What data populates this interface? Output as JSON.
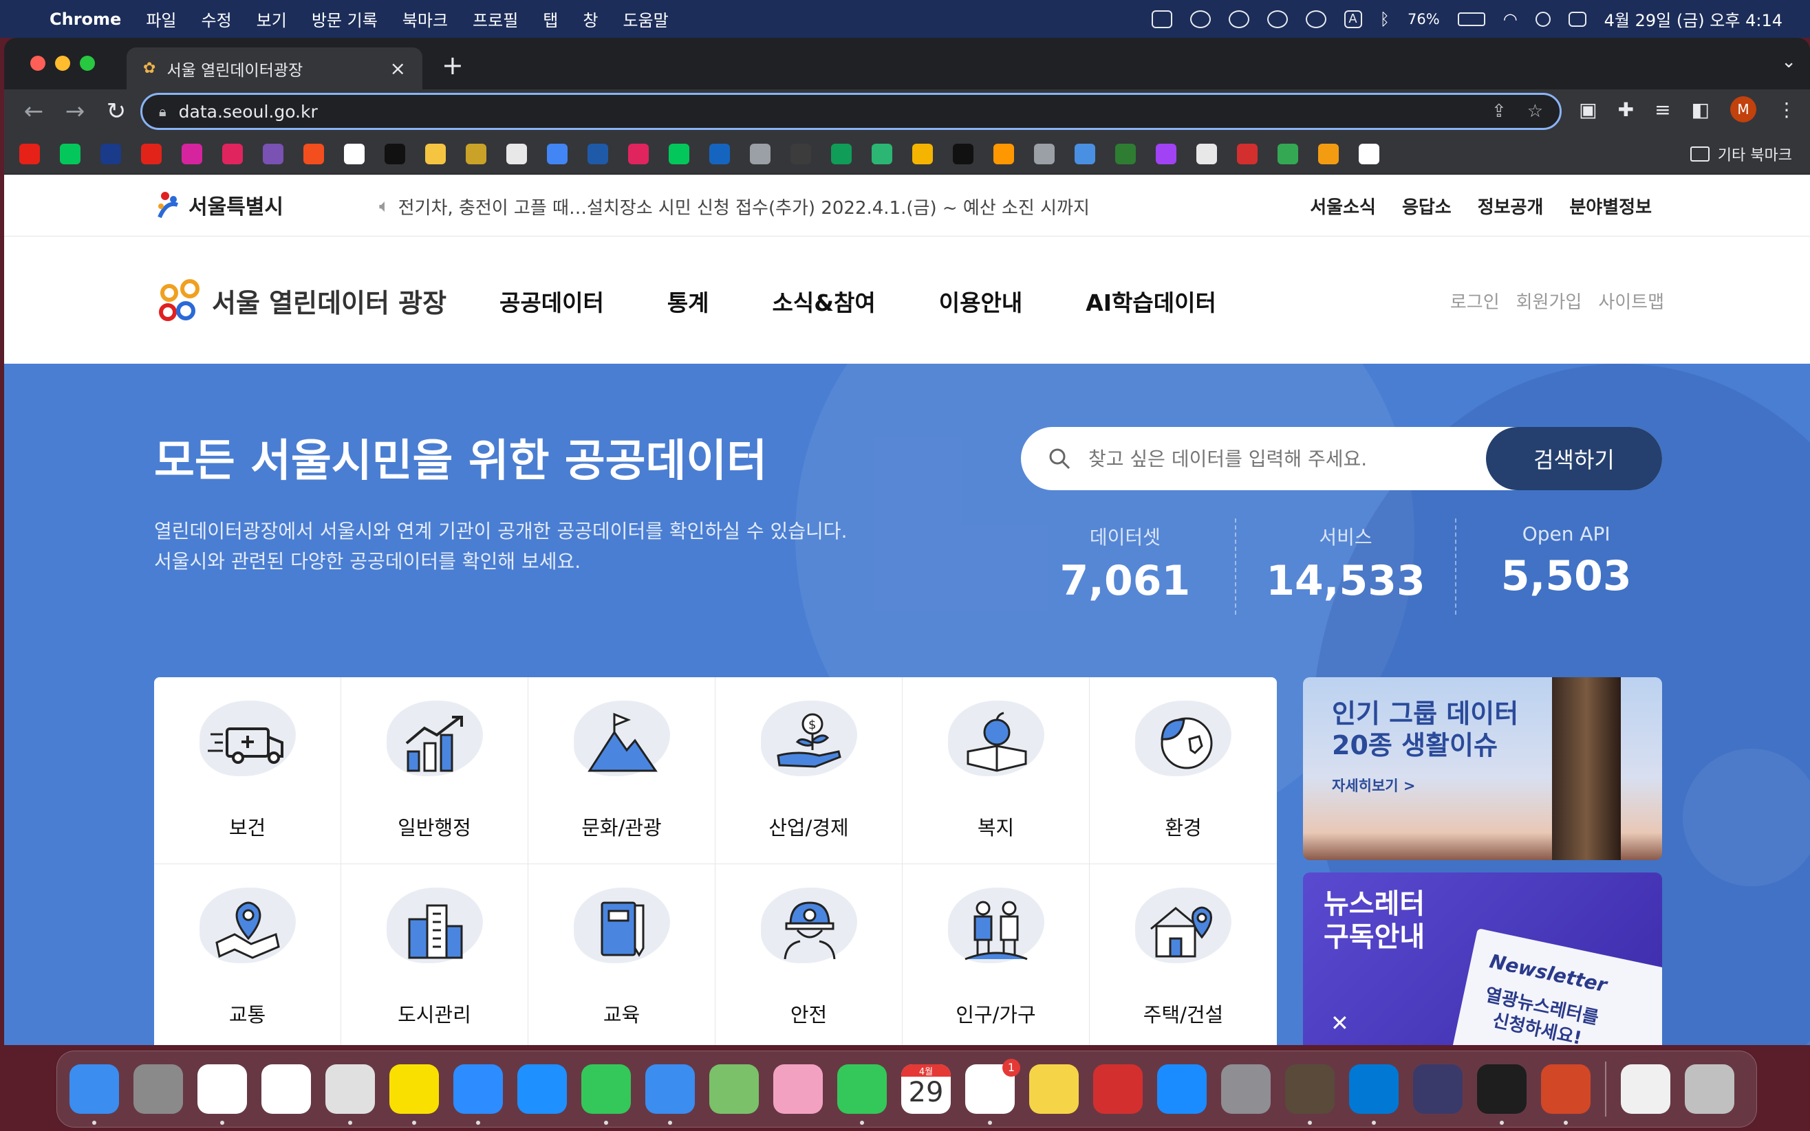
{
  "menubar": {
    "app": "Chrome",
    "items": [
      "파일",
      "수정",
      "보기",
      "방문 기록",
      "북마크",
      "프로필",
      "탭",
      "창",
      "도움말"
    ],
    "battery": "76%",
    "datetime": "4월 29일 (금) 오후 4:14"
  },
  "browser": {
    "tab_title": "서울 열린데이터광장",
    "url": "data.seoul.go.kr",
    "avatar_letter": "M",
    "other_bookmarks": "기타 북마크",
    "bookmark_colors": [
      "#e62117",
      "#03c75a",
      "#1a3a8a",
      "#e2231a",
      "#d6249f",
      "#e0245e",
      "#7952b3",
      "#f24e1e",
      "#ffffff",
      "#111111",
      "#f5c542",
      "#c9a227",
      "#e8e8e8",
      "#4285f4",
      "#1e5aa8",
      "#e0245e",
      "#03c75a",
      "#1565c0",
      "#9aa0a6",
      "#3c3c3c",
      "#0f9d58",
      "#2bb673",
      "#f4b400",
      "#111111",
      "#ff9800",
      "#9aa0a6",
      "#4a90e2",
      "#2e7d32",
      "#a142f4",
      "#e8e8e8",
      "#d32f2f",
      "#34a853",
      "#f39c12",
      "#ffffff"
    ]
  },
  "site": {
    "gov_logo": "서울특별시",
    "notice": "전기차, 충전이 고플 때…설치장소 시민 신청 접수(추가) 2022.4.1.(금) ~ 예산 소진 시까지",
    "top_links": [
      "서울소식",
      "응답소",
      "정보공개",
      "분야별정보"
    ],
    "logo_text": "서울 열린데이터 광장",
    "main_nav": [
      "공공데이터",
      "통계",
      "소식&참여",
      "이용안내",
      "AI학습데이터"
    ],
    "util_nav": [
      "로그인",
      "회원가입",
      "사이트맵"
    ]
  },
  "hero": {
    "title": "모든 서울시민을 위한 공공데이터",
    "desc_line1": "열린데이터광장에서 서울시와 연계 기관이 공개한 공공데이터를 확인하실 수 있습니다.",
    "desc_line2": "서울시와 관련된 다양한 공공데이터를 확인해 보세요.",
    "search_placeholder": "찾고 싶은 데이터를 입력해 주세요.",
    "search_button": "검색하기",
    "stats": [
      {
        "label": "데이터셋",
        "value": "7,061"
      },
      {
        "label": "서비스",
        "value": "14,533"
      },
      {
        "label": "Open API",
        "value": "5,503"
      }
    ]
  },
  "categories": [
    {
      "label": "보건",
      "icon": "ambulance-icon"
    },
    {
      "label": "일반행정",
      "icon": "growth-chart-icon"
    },
    {
      "label": "문화/관광",
      "icon": "mountain-flag-icon"
    },
    {
      "label": "산업/경제",
      "icon": "money-plant-icon"
    },
    {
      "label": "복지",
      "icon": "apple-book-icon"
    },
    {
      "label": "환경",
      "icon": "leaf-globe-icon"
    },
    {
      "label": "교통",
      "icon": "map-pin-icon"
    },
    {
      "label": "도시관리",
      "icon": "buildings-icon"
    },
    {
      "label": "교육",
      "icon": "book-pencil-icon"
    },
    {
      "label": "안전",
      "icon": "hardhat-worker-icon"
    },
    {
      "label": "인구/가구",
      "icon": "family-icon"
    },
    {
      "label": "주택/건설",
      "icon": "house-pin-icon"
    }
  ],
  "banners": {
    "group_title1": "인기 그룹 데이터",
    "group_title2": "20종 생활이슈",
    "group_more": "자세히보기 >",
    "newsletter_title1": "뉴스레터",
    "newsletter_title2": "구독안내",
    "newsletter_word": "Newsletter",
    "newsletter_sub1": "열광뉴스레터를",
    "newsletter_sub2": "신청하세요!"
  },
  "dock": {
    "calendar_month": "4월",
    "calendar_day": "29",
    "reminders_badge": "1",
    "colors": [
      "#3b8df0",
      "#8a8a8a",
      "#ffffff",
      "#ffffff",
      "#e0e0e0",
      "#f9e000",
      "#2d8cff",
      "#1e90ff",
      "#34c759",
      "#3b8df0",
      "#7ac16a",
      "#f2a2c0",
      "#34c759",
      "#ffffff",
      "#ffffff",
      "#f5d547",
      "#d32f2f",
      "#1a8cff",
      "#8e8e93",
      "#5a4a3a",
      "#0078d4",
      "#3a3a6a",
      "#1e1e1e",
      "#d24726",
      "#f0f0f0",
      "#c0c0c0"
    ]
  }
}
